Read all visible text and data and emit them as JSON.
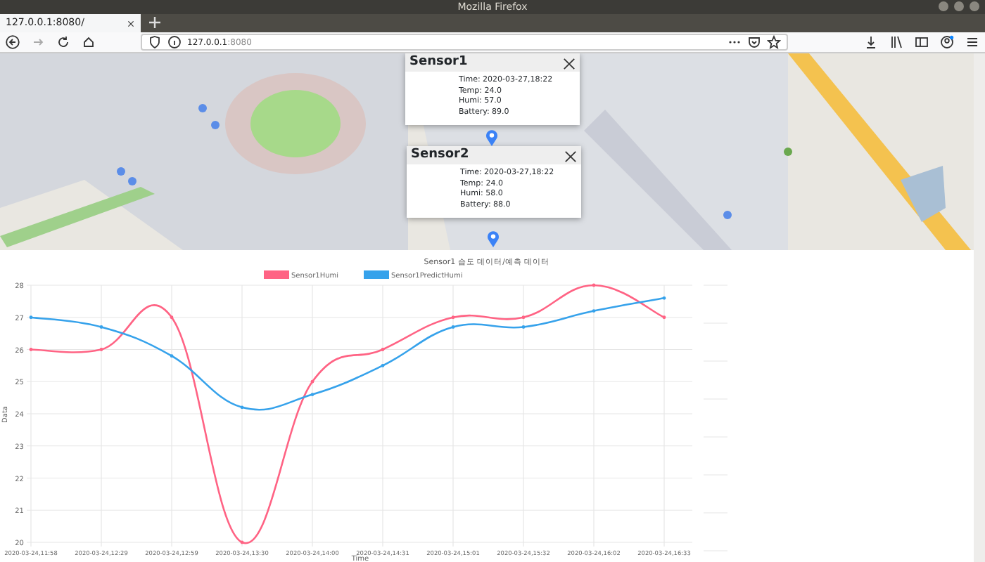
{
  "window": {
    "title": "Mozilla Firefox"
  },
  "tabs": [
    {
      "label": "127.0.0.1:8080/",
      "selected": true
    }
  ],
  "address_bar": {
    "host": "127.0.0.1",
    "port": ":8080"
  },
  "popups": [
    {
      "title": "Sensor1",
      "lines": [
        "Time: 2020-03-27,18:22",
        "Temp: 24.0",
        "Humi: 57.0",
        "Battery: 89.0"
      ]
    },
    {
      "title": "Sensor2",
      "lines": [
        "Time: 2020-03-27,18:22",
        "Temp: 24.0",
        "Humi: 58.0",
        "Battery: 88.0"
      ]
    }
  ],
  "chart": {
    "chart_data": {
      "type": "line",
      "title": "Sensor1 습도 데이터/예측 데이터",
      "xlabel": "Time",
      "ylabel": "Data",
      "categories": [
        "2020-03-24,11:58",
        "2020-03-24,12:29",
        "2020-03-24,12:59",
        "2020-03-24,13:30",
        "2020-03-24,14:00",
        "2020-03-24,14:31",
        "2020-03-24,15:01",
        "2020-03-24,15:32",
        "2020-03-24,16:02",
        "2020-03-24,16:33"
      ],
      "series": [
        {
          "name": "Sensor1Humi",
          "color": "#ff6384",
          "values": [
            26,
            26,
            27,
            20,
            25,
            26,
            27,
            27,
            28,
            27
          ]
        },
        {
          "name": "Sensor1PredictHumi",
          "color": "#36a2eb",
          "values": [
            27,
            26.7,
            25.8,
            24.2,
            24.6,
            25.5,
            26.7,
            26.7,
            27.2,
            27.6
          ]
        }
      ],
      "grid": true,
      "legend": true,
      "ylim": [
        20,
        28
      ],
      "yticks": [
        20,
        21,
        22,
        23,
        24,
        25,
        26,
        27,
        28
      ]
    }
  }
}
